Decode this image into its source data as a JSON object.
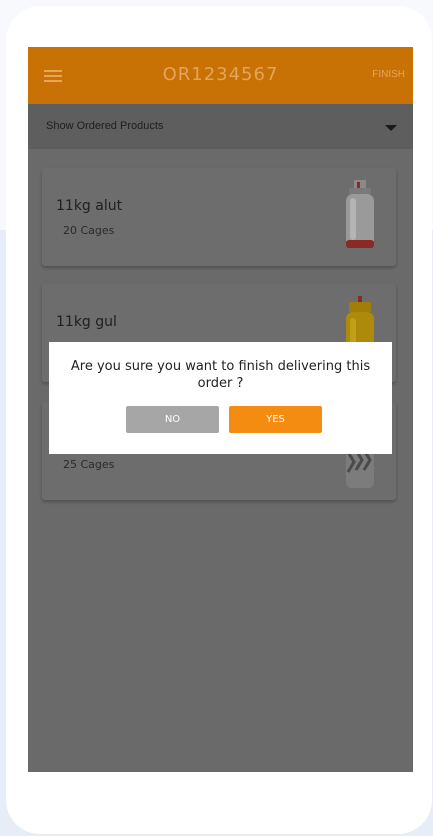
{
  "header": {
    "order_id": "OR1234567",
    "finish_label": "FINISH",
    "menu_icon": "hamburger-menu-icon"
  },
  "filter": {
    "label": "Show Ordered Products",
    "icon": "caret-down-icon"
  },
  "products": [
    {
      "name": "11kg alut",
      "quantity": "20 Cages",
      "image": "gas-cylinder-silver-red"
    },
    {
      "name": "11kg gul",
      "quantity": "",
      "image": "gas-cylinder-yellow"
    },
    {
      "name": "",
      "quantity": "25 Cages",
      "image": "gas-cylinder-composite"
    }
  ],
  "dialog": {
    "message": "Are you sure you want to finish delivering this order ?",
    "no_label": "NO",
    "yes_label": "YES"
  },
  "colors": {
    "brand_orange": "#f58c12",
    "appbar_dimmed": "#c87206",
    "no_button": "#a6a6a6"
  }
}
